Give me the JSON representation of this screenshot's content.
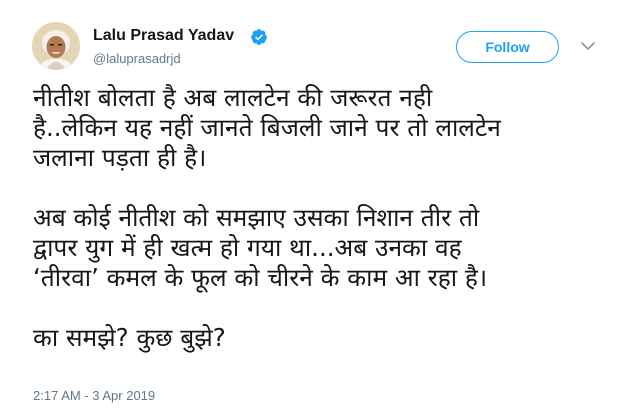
{
  "tweet": {
    "author": {
      "name": "Lalu Prasad Yadav",
      "handle": "@laluprasadrjd",
      "verified": true
    },
    "follow_label": "Follow",
    "paragraphs": [
      "नीतीश बोलता है अब लालटेन की जरूरत नही\nहै..लेकिन यह नहीं जानते बिजली जाने पर तो लालटेन\nजलाना पड़ता ही है।",
      "अब कोई नीतीश को समझाए उसका निशान तीर तो\nद्वापर युग में ही खत्म हो गया था...अब उनका वह\n‘तीरवा’ कमल के फूल को चीरने के काम आ रहा है।",
      "का समझे? कुछ बुझे?"
    ],
    "timestamp": "2:17 AM - 3 Apr 2019"
  },
  "colors": {
    "accent": "#1da1f2",
    "text": "#14171a",
    "secondary_text": "#657786"
  },
  "icons": {
    "verified": "verified-badge-icon",
    "caret": "chevron-down-icon"
  }
}
